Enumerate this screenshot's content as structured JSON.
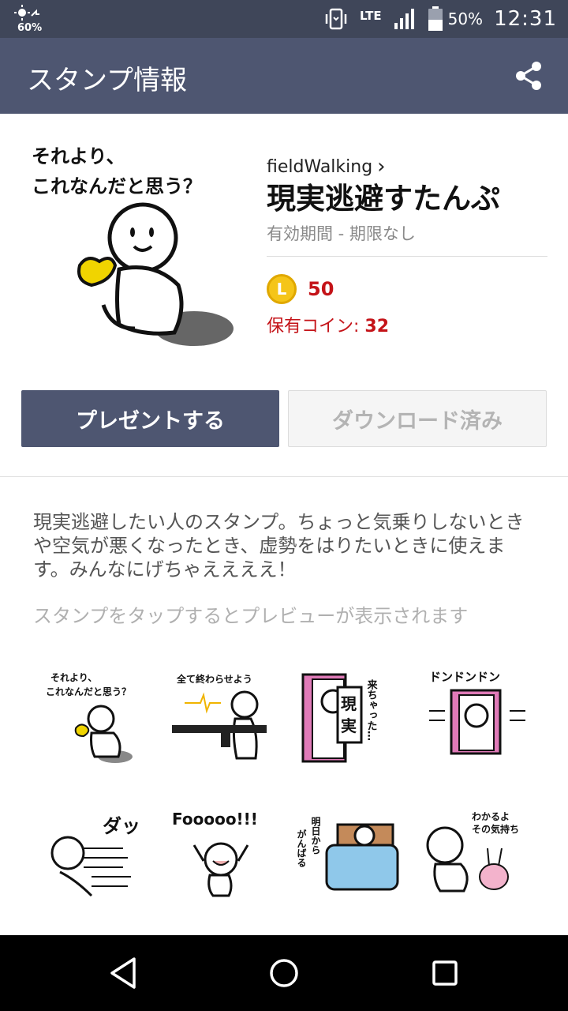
{
  "status_bar": {
    "small_battery": "60%",
    "network": "LTE",
    "battery": "50%",
    "time": "12:31"
  },
  "app_bar": {
    "title": "スタンプ情報",
    "share_icon": "share-icon"
  },
  "package": {
    "author": "fieldWalking",
    "author_chevron": "›",
    "title": "現実逃避すたんぷ",
    "validity": "有効期間 - 期限なし",
    "coin_icon_letter": "L",
    "price": "50",
    "owned_label": "保有コイン:",
    "owned_value": "32",
    "main_sticker_text_line1": "それより、",
    "main_sticker_text_line2": "これなんだと思う？"
  },
  "buttons": {
    "present": "プレゼントする",
    "downloaded": "ダウンロード済み"
  },
  "description": "現実逃避したい人のスタンプ。ちょっと気乗りしないときや空気が悪くなったとき、虚勢をはりたいときに使えます。みんなにげちゃええええ！",
  "hint": "スタンプをタップするとプレビューが表示されます",
  "stickers": [
    {
      "name": "sticker-what-is-this",
      "text": "それより、これなんだと思う？"
    },
    {
      "name": "sticker-finish-all",
      "text": "全て終わらせよう"
    },
    {
      "name": "sticker-reality-came",
      "text": "来ちゃった…",
      "sign": "現実"
    },
    {
      "name": "sticker-don-don",
      "text": "ドンドンドン"
    },
    {
      "name": "sticker-dash",
      "text": "ダッ"
    },
    {
      "name": "sticker-fooooo",
      "text": "Fooooo!!!"
    },
    {
      "name": "sticker-from-tomorrow",
      "text": "明日からがんばる"
    },
    {
      "name": "sticker-understand",
      "text": "わかるよその気持ち"
    }
  ],
  "nav": {
    "back": "back-icon",
    "home": "home-icon",
    "recents": "recents-icon"
  },
  "colors": {
    "status_bar": "#3f4659",
    "app_bar": "#4e5671",
    "price_red": "#c41318",
    "coin": "#f5c518"
  }
}
